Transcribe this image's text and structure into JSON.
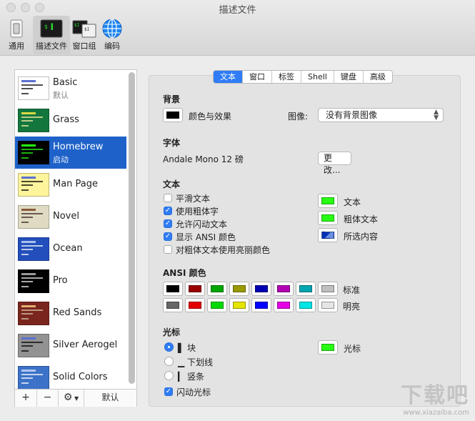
{
  "window": {
    "title": "描述文件"
  },
  "toolbar": [
    {
      "label": "通用",
      "icon": "switch-icon"
    },
    {
      "label": "描述文件",
      "icon": "terminal-profile-icon",
      "selected": true
    },
    {
      "label": "窗口组",
      "icon": "window-group-icon"
    },
    {
      "label": "编码",
      "icon": "globe-icon"
    }
  ],
  "profiles": [
    {
      "name": "Basic",
      "sub": "默认",
      "bg": "#ffffff",
      "fg": "#000000",
      "accent": "#5b6fd1"
    },
    {
      "name": "Grass",
      "sub": "",
      "bg": "#13773d",
      "fg": "#fff0a5",
      "accent": "#d9d945"
    },
    {
      "name": "Homebrew",
      "sub": "启动",
      "bg": "#000000",
      "fg": "#28fe14",
      "accent": "#28fe14",
      "selected": true
    },
    {
      "name": "Man Page",
      "sub": "",
      "bg": "#fef49c",
      "fg": "#000000",
      "accent": "#5b6fd1"
    },
    {
      "name": "Novel",
      "sub": "",
      "bg": "#dfdbc3",
      "fg": "#3b2322",
      "accent": "#8a5a3a"
    },
    {
      "name": "Ocean",
      "sub": "",
      "bg": "#224fbc",
      "fg": "#ffffff",
      "accent": "#a9c1f0"
    },
    {
      "name": "Pro",
      "sub": "",
      "bg": "#000000",
      "fg": "#f2f2f2",
      "accent": "#9a9a9a"
    },
    {
      "name": "Red Sands",
      "sub": "",
      "bg": "#7a251e",
      "fg": "#d7c9a7",
      "accent": "#e0b070"
    },
    {
      "name": "Silver Aerogel",
      "sub": "",
      "bg": "#929292",
      "fg": "#000000",
      "accent": "#5b6fd1"
    },
    {
      "name": "Solid Colors",
      "sub": "",
      "bg": "#3c72c8",
      "fg": "#ffffff",
      "accent": "#b0c8f0"
    }
  ],
  "list_footer": {
    "add": "+",
    "remove": "−",
    "gear": "⚙",
    "default_label": "默认"
  },
  "tabs": [
    {
      "label": "文本",
      "selected": true
    },
    {
      "label": "窗口"
    },
    {
      "label": "标签"
    },
    {
      "label": "Shell"
    },
    {
      "label": "键盘"
    },
    {
      "label": "高级"
    }
  ],
  "background": {
    "section": "背景",
    "color_effects_label": "颜色与效果",
    "image_label": "图像:",
    "image_value": "没有背景图像"
  },
  "font": {
    "section": "字体",
    "name": "Andale Mono 12 磅",
    "change_button": "更改..."
  },
  "text": {
    "section": "文本",
    "options": [
      {
        "label": "平滑文本",
        "checked": false
      },
      {
        "label": "使用粗体字",
        "checked": true
      },
      {
        "label": "允许闪动文本",
        "checked": true
      },
      {
        "label": "显示 ANSI 颜色",
        "checked": true
      },
      {
        "label": "对粗体文本使用亮丽颜色",
        "checked": false
      }
    ],
    "color_text_label": "文本",
    "color_bold_label": "粗体文本",
    "color_selection_label": "所选内容",
    "color_text": "#28fe14",
    "color_bold": "#28fe14",
    "color_selection": "#0431b8"
  },
  "ansi": {
    "section": "ANSI 颜色",
    "normal_label": "标准",
    "bright_label": "明亮",
    "normal": [
      "#000000",
      "#990000",
      "#00a600",
      "#999900",
      "#0000b2",
      "#b200b2",
      "#00a6b2",
      "#bfbfbf"
    ],
    "bright": [
      "#666666",
      "#e50000",
      "#00d900",
      "#e5e500",
      "#0000ff",
      "#e500e5",
      "#00e5e5",
      "#e5e5e5"
    ]
  },
  "cursor": {
    "section": "光标",
    "options": [
      {
        "label": "▌ 块",
        "selected": true
      },
      {
        "label": "▁ 下划线",
        "selected": false
      },
      {
        "label": "▎ 竖条",
        "selected": false
      }
    ],
    "blink_label": "闪动光标",
    "blink_checked": true,
    "color_label": "光标",
    "color": "#28fe14"
  },
  "watermark": {
    "big": "下载吧",
    "small": "www.xiazaiba.com"
  }
}
